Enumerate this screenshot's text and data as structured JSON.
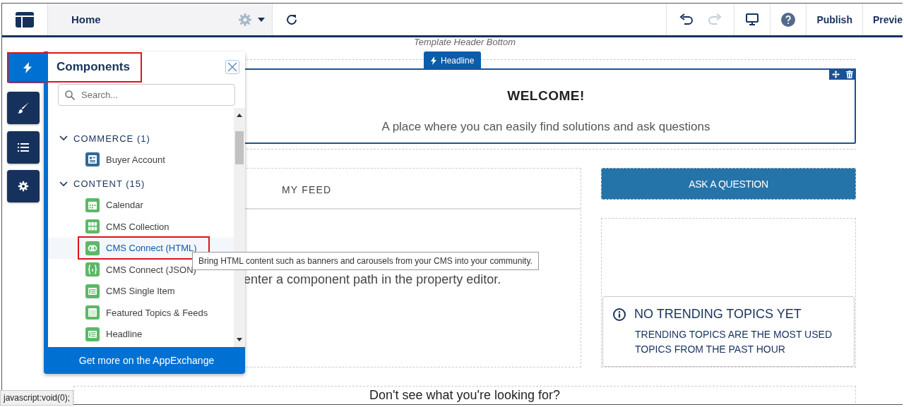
{
  "header": {
    "page": "Home",
    "redo_disabled": true,
    "actions": [
      {
        "label": "Publish"
      },
      {
        "label": "Previe"
      }
    ]
  },
  "canvas": {
    "region_label": "Template Header Bottom",
    "headline_tag": "Headline",
    "welcome": {
      "title": "WELCOME!",
      "subtitle": "A place where you can easily find solutions and ask questions"
    },
    "feed": {
      "tab": "MY FEED",
      "message": "enter a component path in the property editor."
    },
    "ask_button": "ASK A QUESTION",
    "trending": {
      "title": "NO TRENDING TOPICS YET",
      "text": "TRENDING TOPICS ARE THE MOST USED TOPICS FROM THE PAST HOUR"
    },
    "footer_prompt": "Don't see what you're looking for?"
  },
  "rail": [
    {
      "kind": "components",
      "selected": true
    },
    {
      "kind": "theme",
      "selected": false
    },
    {
      "kind": "pages",
      "selected": false
    },
    {
      "kind": "settings",
      "selected": false
    }
  ],
  "panel": {
    "title": "Components",
    "highlighted": true,
    "search": {
      "placeholder": "Search..."
    },
    "sections": [
      {
        "label": "COMMERCE (1)",
        "expanded": true,
        "items": [
          {
            "label": "Buyer Account",
            "kind": "record",
            "hovered": false,
            "highlighted": false
          }
        ]
      },
      {
        "label": "CONTENT (15)",
        "expanded": true,
        "items": [
          {
            "label": "Calendar",
            "kind": "calendar",
            "hovered": false,
            "highlighted": false
          },
          {
            "label": "CMS Collection",
            "kind": "grid",
            "hovered": false,
            "highlighted": false
          },
          {
            "label": "CMS Connect (HTML)",
            "kind": "rings",
            "hovered": true,
            "highlighted": true
          },
          {
            "label": "CMS Connect (JSON)",
            "kind": "braces",
            "hovered": false,
            "highlighted": false
          },
          {
            "label": "CMS Single Item",
            "kind": "table",
            "hovered": false,
            "highlighted": false
          },
          {
            "label": "Featured Topics & Feeds",
            "kind": "window",
            "hovered": false,
            "highlighted": false
          },
          {
            "label": "Headline",
            "kind": "table",
            "hovered": false,
            "highlighted": false
          }
        ]
      }
    ],
    "footer": "Get more on the AppExchange"
  },
  "tooltip": "Bring HTML content such as banners and carousels from your CMS into your community.",
  "status_bar": "javascript:void(0);"
}
